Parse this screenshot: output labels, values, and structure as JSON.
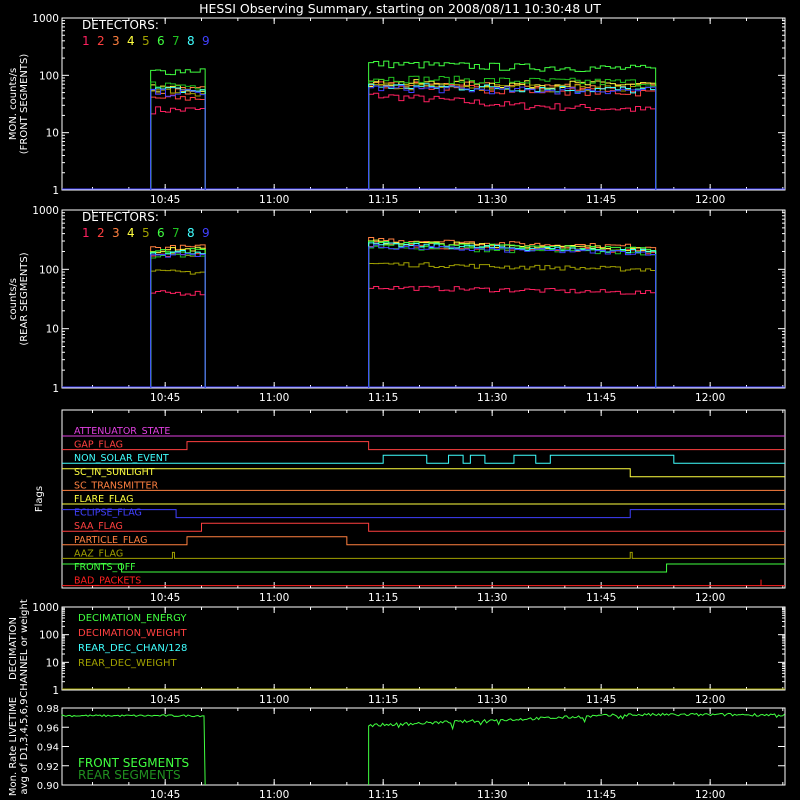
{
  "title": "HESSI Observing Summary, starting on 2008/08/11 10:30:48 UT",
  "time_ticks": [
    "10:45",
    "11:00",
    "11:15",
    "11:30",
    "11:45",
    "12:00"
  ],
  "detector_colors": [
    "#ff2060",
    "#ff4040",
    "#ff8040",
    "#ffff40",
    "#a0a000",
    "#40ff40",
    "#20c020",
    "#40ffff",
    "#4040ff"
  ],
  "detector_numbers": [
    "1",
    "2",
    "3",
    "4",
    "5",
    "6",
    "7",
    "8",
    "9"
  ],
  "chart_data": [
    {
      "type": "line",
      "ylabel_lines": [
        "MON. counts/s",
        "(FRONT SEGMENTS)"
      ],
      "legend_title": "DETECTORS:",
      "yscale": "log",
      "ylim": [
        1,
        1000
      ],
      "y_tick_labels": [
        "1",
        "10",
        "100",
        "1000"
      ],
      "gaps_utc": [
        [
          "10:30:48",
          "10:43:00"
        ],
        [
          "10:50:30",
          "11:13:00"
        ],
        [
          "11:52:30",
          "12:10:00"
        ]
      ],
      "series": [
        {
          "name": "1",
          "values_segment1": [
            25,
            25
          ],
          "values_segment2": [
            45,
            30,
            25
          ]
        },
        {
          "name": "2",
          "values_segment1": [
            40,
            40
          ],
          "values_segment2": [
            70,
            55,
            50
          ]
        },
        {
          "name": "3",
          "values_segment1": [
            55,
            55
          ],
          "values_segment2": [
            70,
            65,
            65
          ]
        },
        {
          "name": "4",
          "values_segment1": [
            60,
            60
          ],
          "values_segment2": [
            75,
            70,
            70
          ]
        },
        {
          "name": "5",
          "values_segment1": [
            50,
            50
          ],
          "values_segment2": [
            65,
            60,
            60
          ]
        },
        {
          "name": "6",
          "values_segment1": [
            115,
            125
          ],
          "values_segment2": [
            160,
            140,
            130
          ]
        },
        {
          "name": "7",
          "values_segment1": [
            70,
            65
          ],
          "values_segment2": [
            90,
            80,
            75
          ]
        },
        {
          "name": "8",
          "values_segment1": [
            55,
            55
          ],
          "values_segment2": [
            65,
            60,
            55
          ]
        },
        {
          "name": "9",
          "values_segment1": [
            50,
            50
          ],
          "values_segment2": [
            60,
            55,
            55
          ]
        }
      ]
    },
    {
      "type": "line",
      "ylabel_lines": [
        "counts/s",
        "(REAR SEGMENTS)"
      ],
      "legend_title": "DETECTORS:",
      "yscale": "log",
      "ylim": [
        1,
        1000
      ],
      "y_tick_labels": [
        "1",
        "10",
        "100",
        "1000"
      ],
      "series": [
        {
          "name": "1",
          "values_segment1": [
            40,
            40
          ],
          "values_segment2": [
            50,
            45,
            40
          ]
        },
        {
          "name": "2",
          "values_segment1": [
            180,
            180
          ],
          "values_segment2": [
            260,
            220,
            200
          ]
        },
        {
          "name": "3",
          "values_segment1": [
            230,
            240
          ],
          "values_segment2": [
            320,
            270,
            240
          ]
        },
        {
          "name": "4",
          "values_segment1": [
            210,
            220
          ],
          "values_segment2": [
            290,
            250,
            220
          ]
        },
        {
          "name": "5",
          "values_segment1": [
            90,
            90
          ],
          "values_segment2": [
            125,
            110,
            100
          ]
        },
        {
          "name": "6",
          "values_segment1": [
            200,
            210
          ],
          "values_segment2": [
            280,
            240,
            220
          ]
        },
        {
          "name": "7",
          "values_segment1": [
            170,
            180
          ],
          "values_segment2": [
            240,
            210,
            190
          ]
        },
        {
          "name": "8",
          "values_segment1": [
            190,
            200
          ],
          "values_segment2": [
            260,
            230,
            200
          ]
        },
        {
          "name": "9",
          "values_segment1": [
            175,
            180
          ],
          "values_segment2": [
            240,
            210,
            190
          ]
        }
      ]
    },
    {
      "type": "line",
      "ylabel": "Flags",
      "flags": [
        {
          "label": "ATTENUATOR_STATE",
          "color": "#e040e0"
        },
        {
          "label": "GAP_FLAG",
          "color": "#ff4040"
        },
        {
          "label": "NON_SOLAR_EVENT",
          "color": "#40ffff"
        },
        {
          "label": "SC_IN_SUNLIGHT",
          "color": "#ffff40"
        },
        {
          "label": "SC_TRANSMITTER",
          "color": "#ff8040"
        },
        {
          "label": "FLARE_FLAG",
          "color": "#ffff40"
        },
        {
          "label": "ECLIPSE_FLAG",
          "color": "#4040ff"
        },
        {
          "label": "SAA_FLAG",
          "color": "#ff4040"
        },
        {
          "label": "PARTICLE_FLAG",
          "color": "#ff8040"
        },
        {
          "label": "AAZ_FLAG",
          "color": "#a0a000"
        },
        {
          "label": "FRONTS_OFF",
          "color": "#40ff40"
        },
        {
          "label": "BAD_PACKETS",
          "color": "#ff2020"
        }
      ]
    },
    {
      "type": "line",
      "ylabel_lines": [
        "DECIMATION",
        "CHANNEL or weight"
      ],
      "yscale": "log",
      "ylim": [
        1,
        1000
      ],
      "y_tick_labels": [
        "1",
        "10",
        "100",
        "1000"
      ],
      "legend": [
        {
          "label": "DECIMATION_ENERGY",
          "color": "#40ff40"
        },
        {
          "label": "DECIMATION_WEIGHT",
          "color": "#ff4040"
        },
        {
          "label": "REAR_DEC_CHAN/128",
          "color": "#40ffff"
        },
        {
          "label": "REAR_DEC_WEIGHT",
          "color": "#a0a000"
        }
      ]
    },
    {
      "type": "line",
      "ylabel_lines": [
        "Mon. Rate LIVETIME",
        "avg of D1,3,4,5,6,9"
      ],
      "ylim": [
        0.9,
        0.98
      ],
      "y_tick_labels": [
        "0.90",
        "0.92",
        "0.94",
        "0.96",
        "0.98"
      ],
      "legend": [
        {
          "label": "FRONT SEGMENTS",
          "color": "#40ff40"
        },
        {
          "label": "REAR SEGMENTS",
          "color": "#209020"
        }
      ],
      "values": {
        "front_segment1": 0.972,
        "front_segment2_start": 0.962,
        "front_segment2_end": 0.973
      }
    }
  ]
}
